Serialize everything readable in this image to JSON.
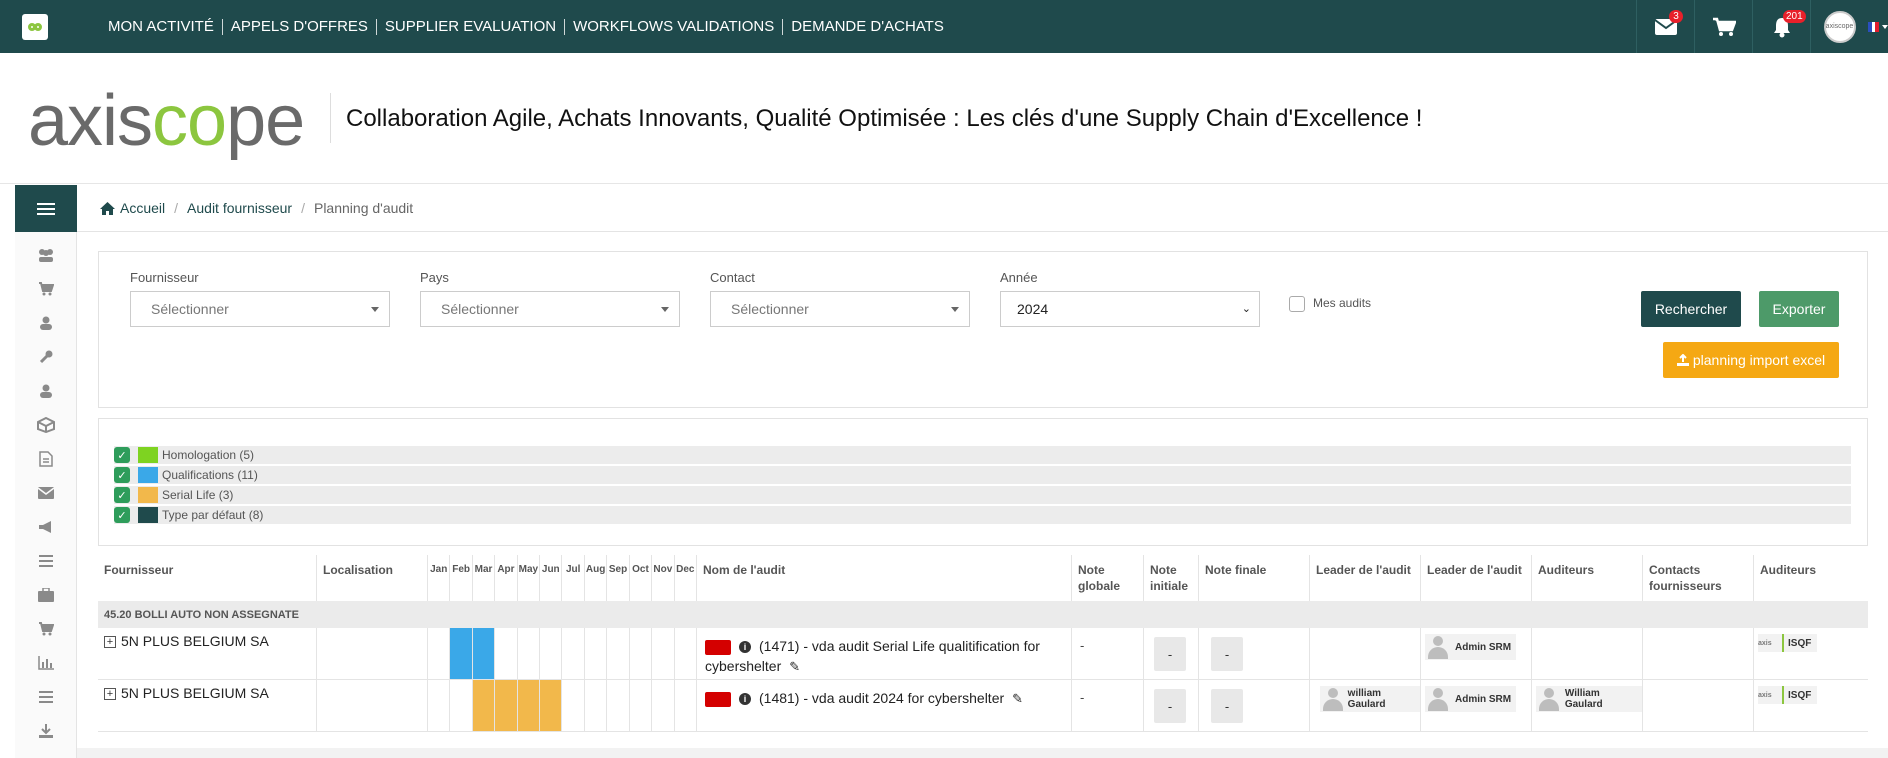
{
  "nav": {
    "items": [
      "MON ACTIVITÉ",
      "APPELS D'OFFRES",
      "SUPPLIER EVALUATION",
      "WORKFLOWS VALIDATIONS",
      "DEMANDE D'ACHATS"
    ],
    "mail_badge": "3",
    "bell_badge": "201",
    "avatar_text": "axiscope"
  },
  "brand": {
    "logo_left": "axis",
    "logo_green": "co",
    "logo_right": "pe",
    "tagline": "Collaboration Agile, Achats Innovants, Qualité Optimisée : Les clés d'une Supply Chain d'Excellence !"
  },
  "breadcrumb": {
    "home": "Accueil",
    "section": "Audit fournisseur",
    "current": "Planning d'audit"
  },
  "filters": {
    "fournisseur_label": "Fournisseur",
    "fournisseur_value": "Sélectionner",
    "pays_label": "Pays",
    "pays_value": "Sélectionner",
    "contact_label": "Contact",
    "contact_value": "Sélectionner",
    "annee_label": "Année",
    "annee_value": "2024",
    "mes_audits_label": "Mes audits",
    "search_button": "Rechercher",
    "export_button": "Exporter",
    "import_button": "planning import excel"
  },
  "legend": [
    {
      "label": "Homologation",
      "count": "(5)",
      "color": "#7ed321"
    },
    {
      "label": "Qualifications",
      "count": "(11)",
      "color": "#3aa8e8"
    },
    {
      "label": "Serial Life",
      "count": "(3)",
      "color": "#f2b84b"
    },
    {
      "label": "Type par défaut",
      "count": "(8)",
      "color": "#1f4a4c"
    }
  ],
  "table": {
    "headers": {
      "fournisseur": "Fournisseur",
      "localisation": "Localisation",
      "nom": "Nom de l'audit",
      "note_globale": "Note globale",
      "note_initiale": "Note initiale",
      "note_finale": "Note finale",
      "leader1": "Leader de l'audit",
      "leader2": "Leader de l'audit",
      "auditeurs1": "Auditeurs",
      "contacts": "Contacts fournisseurs",
      "auditeurs2": "Auditeurs"
    },
    "months": [
      "Jan",
      "Feb",
      "Mar",
      "Apr",
      "May",
      "Jun",
      "Jul",
      "Aug",
      "Sep",
      "Oct",
      "Nov",
      "Dec"
    ],
    "group": "45.20 BOLLI AUTO NON ASSEGNATE",
    "rows": [
      {
        "fournisseur": "5N PLUS BELGIUM SA",
        "audit": "(1471) - vda audit Serial Life qualitification for cybershelter",
        "note_globale": "-",
        "note_initiale": "-",
        "note_finale": "-",
        "leader1": "",
        "leader2": "Admin SRM",
        "auditeurs": "",
        "auditeurs2": "ISQF",
        "months_active": [
          1,
          2
        ],
        "bar_color": "#3aa8e8"
      },
      {
        "fournisseur": "5N PLUS BELGIUM SA",
        "audit": "(1481) - vda audit 2024 for cybershelter",
        "note_globale": "-",
        "note_initiale": "-",
        "note_finale": "-",
        "leader1": "william Gaulard",
        "leader2": "Admin SRM",
        "auditeurs": "William Gaulard",
        "auditeurs2": "ISQF",
        "months_active": [
          2,
          3,
          4,
          5
        ],
        "bar_color": "#f2b84b"
      }
    ]
  }
}
